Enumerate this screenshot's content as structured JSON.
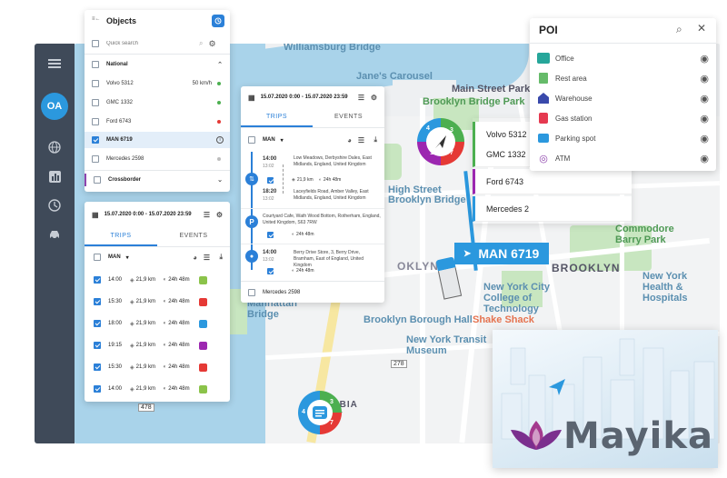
{
  "nav": {
    "avatar": "OA"
  },
  "map": {
    "labels": {
      "williamsburg_bridge": "Williamsburg Bridge",
      "janes_carousel": "Jane's Carousel",
      "main_street_park": "Main Street Park",
      "brooklyn_bridge_park": "Brooklyn Bridge Park",
      "brooklyn_bridge": "Brooklyn Bridge",
      "high_street": "High Street",
      "commodore_barry": "Commodore Barry Park",
      "brooklyn": "BROOKLYN",
      "nycct": "New York City College of Technology",
      "new_york_health": "New York Health & Hospitals",
      "brooklyn_borough_hall": "Brooklyn Borough Hall",
      "shake_shack": "Shake Shack",
      "transit_museum": "New York Transit Museum",
      "manhattan_bridge": "Manhattan Bridge",
      "columbia_street": "COLUMBIA STREET",
      "oklyn": "OKLYN",
      "route_478": "478",
      "route_278": "278"
    }
  },
  "objects_panel": {
    "title": "Objects",
    "search_placeholder": "Quick search",
    "groups": [
      {
        "name": "National"
      },
      {
        "name": "Crossborder"
      }
    ],
    "vehicles": [
      {
        "name": "Volvo 5312",
        "speed": "50 km/h",
        "status_color": "#4caf50",
        "checked": false
      },
      {
        "name": "GMC 1332",
        "speed": "",
        "status_color": "#4caf50",
        "checked": false
      },
      {
        "name": "Ford 6743",
        "speed": "",
        "status_color": "#e53935",
        "checked": false
      },
      {
        "name": "MAN 6719",
        "speed": "",
        "status_color": "",
        "checked": true
      },
      {
        "name": "Mercedes 2598",
        "speed": "",
        "status_color": "#bdbdbd",
        "checked": false
      }
    ]
  },
  "trips_panel": {
    "date_range": "15.07.2020 0:00 - 15.07.2020 23:59",
    "tabs": [
      "TRIPS",
      "EVENTS"
    ],
    "vehicle": "MAN",
    "rows": [
      {
        "time": "14:00",
        "distance": "21,9 km",
        "duration": "24h 48m",
        "color": "#8bc34a"
      },
      {
        "time": "15:30",
        "distance": "21,9 km",
        "duration": "24h 48m",
        "color": "#e53935"
      },
      {
        "time": "18:00",
        "distance": "21,9 km",
        "duration": "24h 48m",
        "color": "#2b98de"
      },
      {
        "time": "19:15",
        "distance": "21,9 km",
        "duration": "24h 48m",
        "color": "#9c27b0"
      },
      {
        "time": "15:30",
        "distance": "21,9 km",
        "duration": "24h 48m",
        "color": "#e53935"
      },
      {
        "time": "14:00",
        "distance": "21,9 km",
        "duration": "24h 48m",
        "color": "#8bc34a"
      }
    ]
  },
  "detail_panel": {
    "date_range": "15.07.2020 0:00 - 15.07.2020 23:59",
    "tabs": [
      "TRIPS",
      "EVENTS"
    ],
    "vehicle": "MAN",
    "entries": [
      {
        "time1": "14:00",
        "sub1": "13:02",
        "addr1": "Low Meadows, Derbyshire Dales, East Midlands, England, United Kingdom",
        "time2": "18:20",
        "sub2": "13:02",
        "addr2": "Laceyfields Road, Amber Valley, East Midlands, England, United Kingdom",
        "distance": "21,9 km",
        "duration": "24h 48m"
      },
      {
        "addr": "Courtyard Cafe, Wath Wood Bottom, Rotherham, England, United Kingdom, S63 7RW",
        "duration": "24h 48m"
      },
      {
        "time1": "14:00",
        "sub1": "13:02",
        "addr1": "Berry Drive Store, 3, Berry Drive, Bramham, East of England, United Kingdom",
        "duration": "24h 48m"
      }
    ],
    "footer_vehicle": "Mercedes 2598"
  },
  "vehicle_list": [
    "Volvo 5312",
    "GMC 1332",
    "Ford 6743",
    "Mercedes 2"
  ],
  "map_tag": {
    "label": "MAN 6719"
  },
  "cluster_top": {
    "values": [
      "4",
      "3",
      "1",
      "7"
    ]
  },
  "cluster_bottom": {
    "values": [
      "4",
      "3",
      "7"
    ]
  },
  "poi_panel": {
    "title": "POI",
    "items": [
      {
        "name": "Office",
        "icon": "office-icon",
        "color": "#26a69a"
      },
      {
        "name": "Rest area",
        "icon": "rest-area-icon",
        "color": "#66bb6a"
      },
      {
        "name": "Warehouse",
        "icon": "warehouse-icon",
        "color": "#3949ab"
      },
      {
        "name": "Gas station",
        "icon": "gas-station-icon",
        "color": "#e53950"
      },
      {
        "name": "Parking spot",
        "icon": "parking-icon",
        "color": "#2b98de"
      },
      {
        "name": "ATM",
        "icon": "atm-icon",
        "color": "#8e44ad"
      }
    ]
  },
  "brand": {
    "name": "Mayika"
  }
}
